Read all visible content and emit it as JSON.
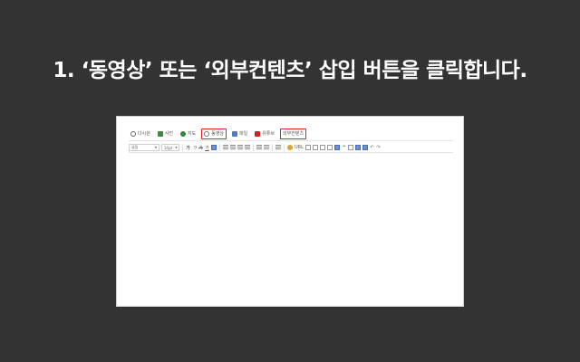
{
  "headline": "1. ‘동영상’ 또는 ‘외부컨텐츠’ 삽입 버튼을 클릭합니다.",
  "attach_bar": {
    "items": [
      {
        "label": "다시쓴",
        "icon": "ghost-icon",
        "color": "#666666",
        "highlight": false
      },
      {
        "label": "사진",
        "icon": "photo-icon",
        "color": "#3d8a3d",
        "highlight": false
      },
      {
        "label": "지도",
        "icon": "map-pin-icon",
        "color": "#2e8b3d",
        "highlight": false
      },
      {
        "label": "동영상",
        "icon": "video-icon",
        "color": "#777777",
        "highlight": true
      },
      {
        "label": "파일",
        "icon": "file-icon",
        "color": "#4a7fc4",
        "highlight": false
      },
      {
        "label": "유튜브",
        "icon": "youtube-icon",
        "color": "#d62020",
        "highlight": false
      },
      {
        "label": "외부컨텐츠",
        "icon": "",
        "color": "#d62020",
        "highlight": true
      }
    ]
  },
  "format_bar": {
    "font_select": "굴림",
    "size_select": "10pt",
    "bold": "가",
    "italic": "가",
    "strike": "가",
    "underline": "가",
    "url": "URL",
    "special": "&#937;"
  },
  "colors": {
    "background": "#333333",
    "highlight_border": "#e02020"
  }
}
